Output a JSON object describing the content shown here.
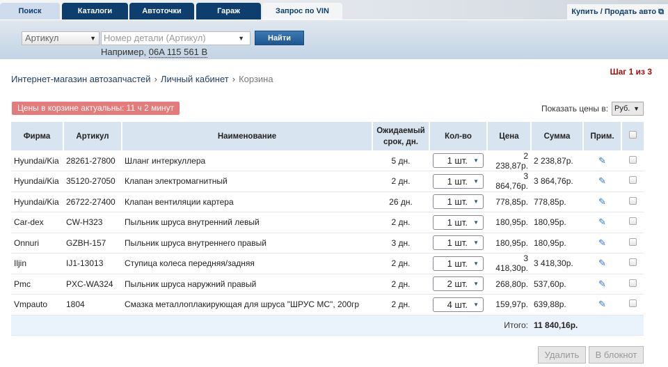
{
  "nav": {
    "tabs": [
      "Поиск",
      "Каталоги",
      "Автоточки",
      "Гараж",
      "Запрос по VIN"
    ],
    "buy_sell": "Купить / Продать авто"
  },
  "search": {
    "type": "Артикул",
    "placeholder": "Номер детали (Артикул)",
    "button": "Найти",
    "example_prefix": "Например, ",
    "example_value": "06A 115 561 B"
  },
  "breadcrumb": [
    "Интернет-магазин автозапчастей",
    "Личный кабинет",
    "Корзина"
  ],
  "step": "Шаг 1 из 3",
  "price_notice": "Цены в корзине актуальны: 11 ч 2 минут",
  "currency": {
    "label": "Показать цены в:",
    "value": "Руб."
  },
  "table": {
    "headers": [
      "Фирма",
      "Артикул",
      "Наименование",
      "Ожидаемый срок, дн.",
      "Кол-во",
      "Цена",
      "Сумма",
      "Прим."
    ],
    "rows": [
      {
        "brand": "Hyundai/Kia",
        "article": "28261-27800",
        "name": "Шланг интеркуллера",
        "term": "5 дн.",
        "qty": "1 шт.",
        "price": "2 238,87р.",
        "sum": "2 238,87р."
      },
      {
        "brand": "Hyundai/Kia",
        "article": "35120-27050",
        "name": "Клапан электромагнитный",
        "term": "2 дн.",
        "qty": "1 шт.",
        "price": "3 864,76р.",
        "sum": "3 864,76р."
      },
      {
        "brand": "Hyundai/Kia",
        "article": "26722-27400",
        "name": "Клапан вентиляции картера",
        "term": "26 дн.",
        "qty": "1 шт.",
        "price": "778,85р.",
        "sum": "778,85р."
      },
      {
        "brand": "Car-dex",
        "article": "CW-H323",
        "name": "Пыльник шруса внутренний левый",
        "term": "2 дн.",
        "qty": "1 шт.",
        "price": "180,95р.",
        "sum": "180,95р."
      },
      {
        "brand": "Onnuri",
        "article": "GZBH-157",
        "name": "Пыльник шруса внутреннего правый",
        "term": "3 дн.",
        "qty": "1 шт.",
        "price": "180,95р.",
        "sum": "180,95р."
      },
      {
        "brand": "Iljin",
        "article": "IJ1-13013",
        "name": "Ступица колеса передняя/задняя",
        "term": "2 дн.",
        "qty": "1 шт.",
        "price": "3 418,30р.",
        "sum": "3 418,30р."
      },
      {
        "brand": "Pmc",
        "article": "PXC-WA324",
        "name": "Пыльник шруса наружний правый",
        "term": "2 дн.",
        "qty": "2 шт.",
        "price": "268,80р.",
        "sum": "537,60р."
      },
      {
        "brand": "Vmpauto",
        "article": "1804",
        "name": "Смазка металлоплакирующая для шруса \"ШРУС МС\", 200гр",
        "term": "2 дн.",
        "qty": "4 шт.",
        "price": "159,97р.",
        "sum": "639,88р."
      }
    ],
    "total_label": "Итого:",
    "total_value": "11 840,16р."
  },
  "actions": {
    "delete": "Удалить",
    "notebook": "В блокнот"
  }
}
